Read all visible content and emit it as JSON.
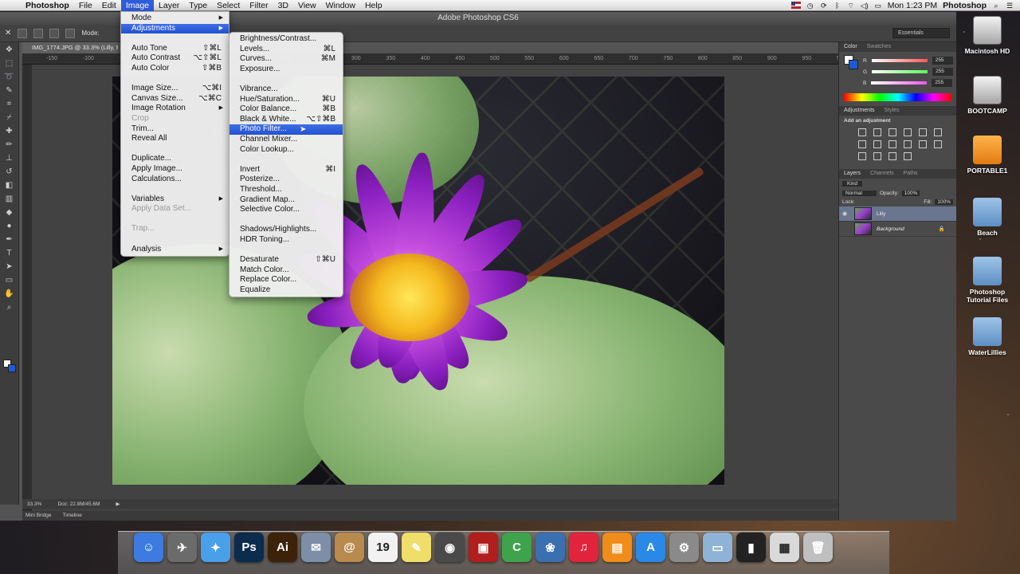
{
  "menubar": {
    "app": "Photoshop",
    "items": [
      "File",
      "Edit",
      "Image",
      "Layer",
      "Type",
      "Select",
      "Filter",
      "3D",
      "View",
      "Window",
      "Help"
    ],
    "active": "Image",
    "clock": "Mon 1:23 PM",
    "right_app": "Photoshop"
  },
  "window_title": "Adobe Photoshop CS6",
  "options_bar": {
    "mode_label": "Mode:",
    "workspace": "Essentials"
  },
  "document": {
    "tab_title": "IMG_1774.JPG @ 33.3% (Lilly, RGB/8)",
    "zoom": "33.3%",
    "doc_size": "Doc: 22.8M/45.6M",
    "ruler_ticks": [
      "-150",
      "-100",
      "-50",
      "0",
      "50",
      "100",
      "150",
      "200",
      "250",
      "300",
      "350",
      "400",
      "450",
      "500",
      "550",
      "600",
      "650",
      "700",
      "750",
      "800",
      "850",
      "900",
      "950",
      "54"
    ]
  },
  "image_menu": [
    {
      "label": "Mode",
      "arrow": true
    },
    {
      "label": "Adjustments",
      "arrow": true,
      "highlight": true
    },
    {
      "sep": true
    },
    {
      "label": "Auto Tone",
      "shortcut": "⇧⌘L"
    },
    {
      "label": "Auto Contrast",
      "shortcut": "⌥⇧⌘L"
    },
    {
      "label": "Auto Color",
      "shortcut": "⇧⌘B"
    },
    {
      "sep": true
    },
    {
      "label": "Image Size...",
      "shortcut": "⌥⌘I"
    },
    {
      "label": "Canvas Size...",
      "shortcut": "⌥⌘C"
    },
    {
      "label": "Image Rotation",
      "arrow": true
    },
    {
      "label": "Crop",
      "disabled": true
    },
    {
      "label": "Trim..."
    },
    {
      "label": "Reveal All"
    },
    {
      "sep": true
    },
    {
      "label": "Duplicate..."
    },
    {
      "label": "Apply Image..."
    },
    {
      "label": "Calculations..."
    },
    {
      "sep": true
    },
    {
      "label": "Variables",
      "arrow": true
    },
    {
      "label": "Apply Data Set...",
      "disabled": true
    },
    {
      "sep": true
    },
    {
      "label": "Trap...",
      "disabled": true
    },
    {
      "sep": true
    },
    {
      "label": "Analysis",
      "arrow": true
    }
  ],
  "adjustments_menu": [
    {
      "label": "Brightness/Contrast..."
    },
    {
      "label": "Levels...",
      "shortcut": "⌘L"
    },
    {
      "label": "Curves...",
      "shortcut": "⌘M"
    },
    {
      "label": "Exposure..."
    },
    {
      "sep": true
    },
    {
      "label": "Vibrance..."
    },
    {
      "label": "Hue/Saturation...",
      "shortcut": "⌘U"
    },
    {
      "label": "Color Balance...",
      "shortcut": "⌘B"
    },
    {
      "label": "Black & White...",
      "shortcut": "⌥⇧⌘B"
    },
    {
      "label": "Photo Filter...",
      "highlight": true
    },
    {
      "label": "Channel Mixer..."
    },
    {
      "label": "Color Lookup..."
    },
    {
      "sep": true
    },
    {
      "label": "Invert",
      "shortcut": "⌘I"
    },
    {
      "label": "Posterize..."
    },
    {
      "label": "Threshold..."
    },
    {
      "label": "Gradient Map..."
    },
    {
      "label": "Selective Color..."
    },
    {
      "sep": true
    },
    {
      "label": "Shadows/Highlights..."
    },
    {
      "label": "HDR Toning..."
    },
    {
      "sep": true
    },
    {
      "label": "Desaturate",
      "shortcut": "⇧⌘U"
    },
    {
      "label": "Match Color..."
    },
    {
      "label": "Replace Color..."
    },
    {
      "label": "Equalize"
    }
  ],
  "panels": {
    "color_tabs": [
      "Color",
      "Swatches"
    ],
    "rgb": [
      {
        "ch": "R",
        "val": "255"
      },
      {
        "ch": "G",
        "val": "255"
      },
      {
        "ch": "B",
        "val": "255"
      }
    ],
    "adj_tabs": [
      "Adjustments",
      "Styles"
    ],
    "add_adjustment": "Add an adjustment",
    "layer_tabs": [
      "Layers",
      "Channels",
      "Paths"
    ],
    "kind": "Kind",
    "blend": "Normal",
    "opacity_label": "Opacity:",
    "opacity": "100%",
    "lock_label": "Lock:",
    "fill_label": "Fill:",
    "fill": "100%",
    "layers": [
      {
        "name": "Lilly",
        "selected": true
      },
      {
        "name": "Background",
        "selected": false
      }
    ]
  },
  "bottom_tabs": [
    "Mini Bridge",
    "Timeline"
  ],
  "desktop_icons": [
    {
      "label": "Macintosh HD",
      "kind": "hd"
    },
    {
      "label": "BOOTCAMP",
      "kind": "hd"
    },
    {
      "label": "PORTABLE1",
      "kind": "usb"
    },
    {
      "label": "Beach",
      "kind": "folder"
    },
    {
      "label": "Photoshop Tutorial Files",
      "kind": "folder"
    },
    {
      "label": "WaterLillies",
      "kind": "folder"
    }
  ],
  "dock": [
    {
      "icon": "finder-icon",
      "glyph": "☺",
      "color": "#3d7be0"
    },
    {
      "icon": "launchpad-icon",
      "glyph": "✈",
      "color": "#6b6b6b"
    },
    {
      "icon": "safari-icon",
      "glyph": "✦",
      "color": "#4aa0e8"
    },
    {
      "icon": "photoshop-icon",
      "glyph": "Ps",
      "color": "#0b2c4d"
    },
    {
      "icon": "illustrator-icon",
      "glyph": "Ai",
      "color": "#3b2208"
    },
    {
      "icon": "mail-stamp-icon",
      "glyph": "✉",
      "color": "#7d8fa8"
    },
    {
      "icon": "contacts-icon",
      "glyph": "@",
      "color": "#b88a4d"
    },
    {
      "icon": "calendar-icon",
      "glyph": "19",
      "color": "#f2f2f2"
    },
    {
      "icon": "stickies-icon",
      "glyph": "✎",
      "color": "#f0de6a"
    },
    {
      "icon": "facetime-icon",
      "glyph": "◉",
      "color": "#4a4a4a"
    },
    {
      "icon": "photo-booth-icon",
      "glyph": "▣",
      "color": "#b01e1e"
    },
    {
      "icon": "camtasia-icon",
      "glyph": "C",
      "color": "#3fa34d"
    },
    {
      "icon": "iphoto-icon",
      "glyph": "❀",
      "color": "#3a6fb0"
    },
    {
      "icon": "itunes-icon",
      "glyph": "♫",
      "color": "#e2233c"
    },
    {
      "icon": "ibooks-icon",
      "glyph": "▤",
      "color": "#f08c1a"
    },
    {
      "icon": "app-store-icon",
      "glyph": "A",
      "color": "#2a88e6"
    },
    {
      "icon": "system-preferences-icon",
      "glyph": "⚙",
      "color": "#8a8a8a"
    },
    {
      "icon": "documents-folder-icon",
      "glyph": "▭",
      "color": "#8fb3d6"
    },
    {
      "icon": "terminal-icon",
      "glyph": "▮",
      "color": "#222"
    },
    {
      "icon": "downloads-icon",
      "glyph": "▦",
      "color": "#d9d9d9"
    },
    {
      "icon": "trash-icon",
      "glyph": "🗑",
      "color": "#bfbfbf"
    }
  ]
}
